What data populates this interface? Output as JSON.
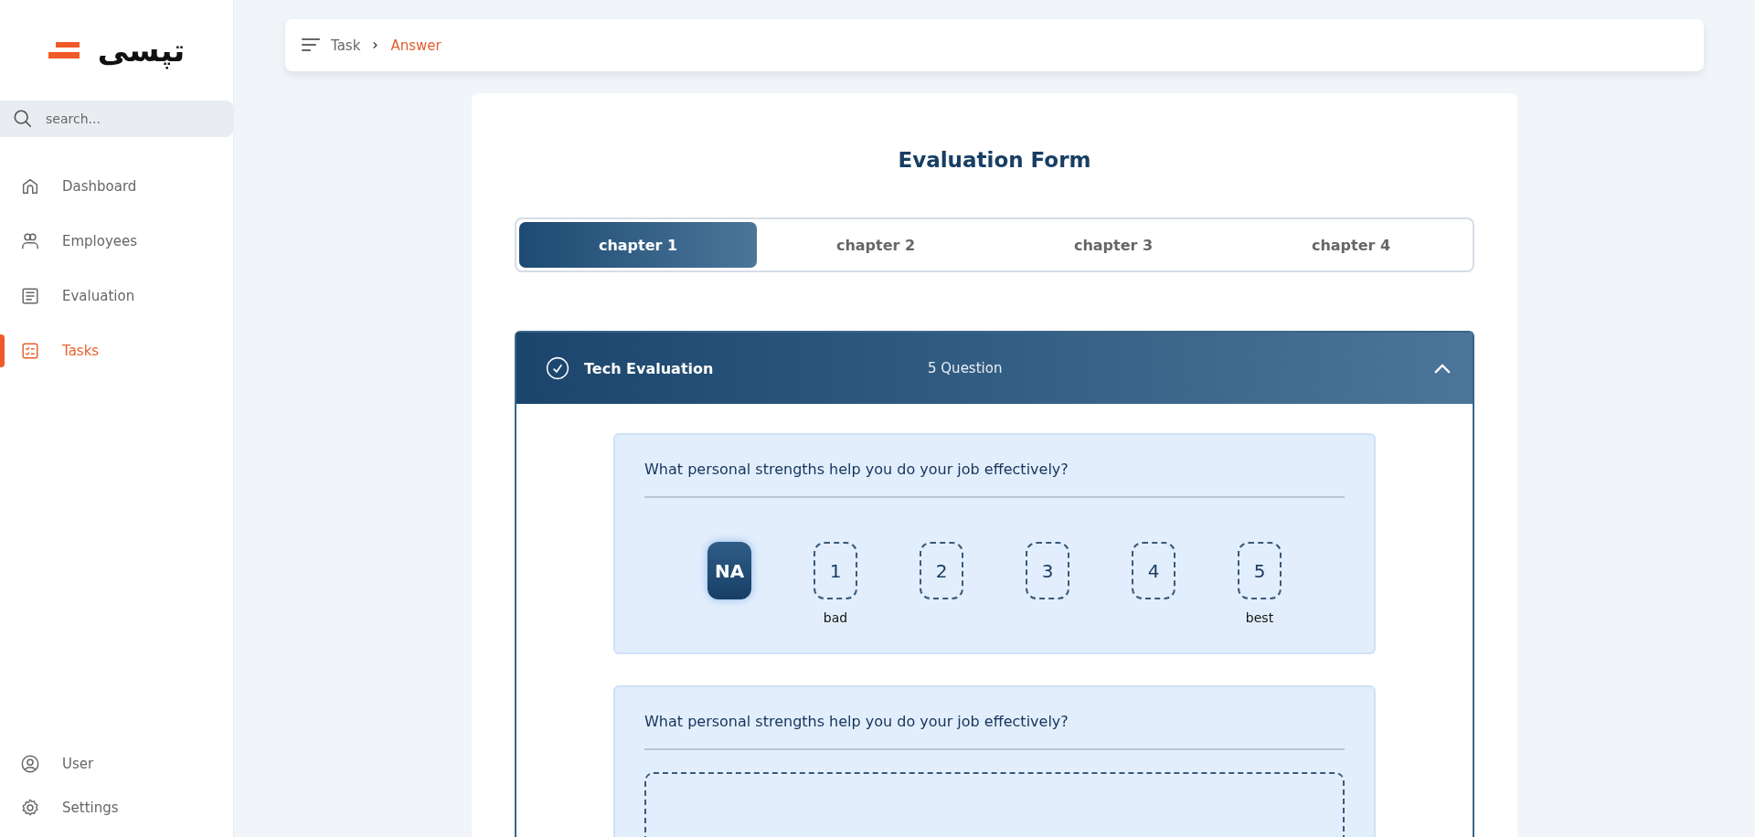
{
  "logo": {
    "text": "تپسی"
  },
  "sidebar": {
    "search": {
      "placeholder": "search..."
    },
    "items": [
      {
        "label": "Dashboard",
        "selected": false
      },
      {
        "label": "Employees",
        "selected": false
      },
      {
        "label": "Evaluation",
        "selected": false
      },
      {
        "label": "Tasks",
        "selected": true
      }
    ],
    "bottom_items": [
      {
        "label": "User"
      },
      {
        "label": "Settings"
      }
    ]
  },
  "breadcrumb": [
    "Task",
    "Answer"
  ],
  "form": {
    "title": "Evaluation Form",
    "tabs": [
      {
        "label": "chapter 1",
        "selected": true
      },
      {
        "label": "chapter 2",
        "selected": false
      },
      {
        "label": "chapter 3",
        "selected": false
      },
      {
        "label": "chapter 4",
        "selected": false
      }
    ],
    "section": {
      "title": "Tech Evaluation",
      "count": "5 Question",
      "expanded": true,
      "questions": [
        {
          "kind": "scale",
          "text": "What personal strengths help you do your job effectively?",
          "options": [
            {
              "label": "NA",
              "selected": true
            },
            {
              "label": "1",
              "caption": "bad",
              "selected": false
            },
            {
              "label": "2",
              "selected": false
            },
            {
              "label": "3",
              "selected": false
            },
            {
              "label": "4",
              "selected": false
            },
            {
              "label": "5",
              "caption": "best",
              "selected": false
            }
          ]
        },
        {
          "kind": "text",
          "text": "What personal strengths help you do your job effectively?"
        }
      ]
    }
  }
}
